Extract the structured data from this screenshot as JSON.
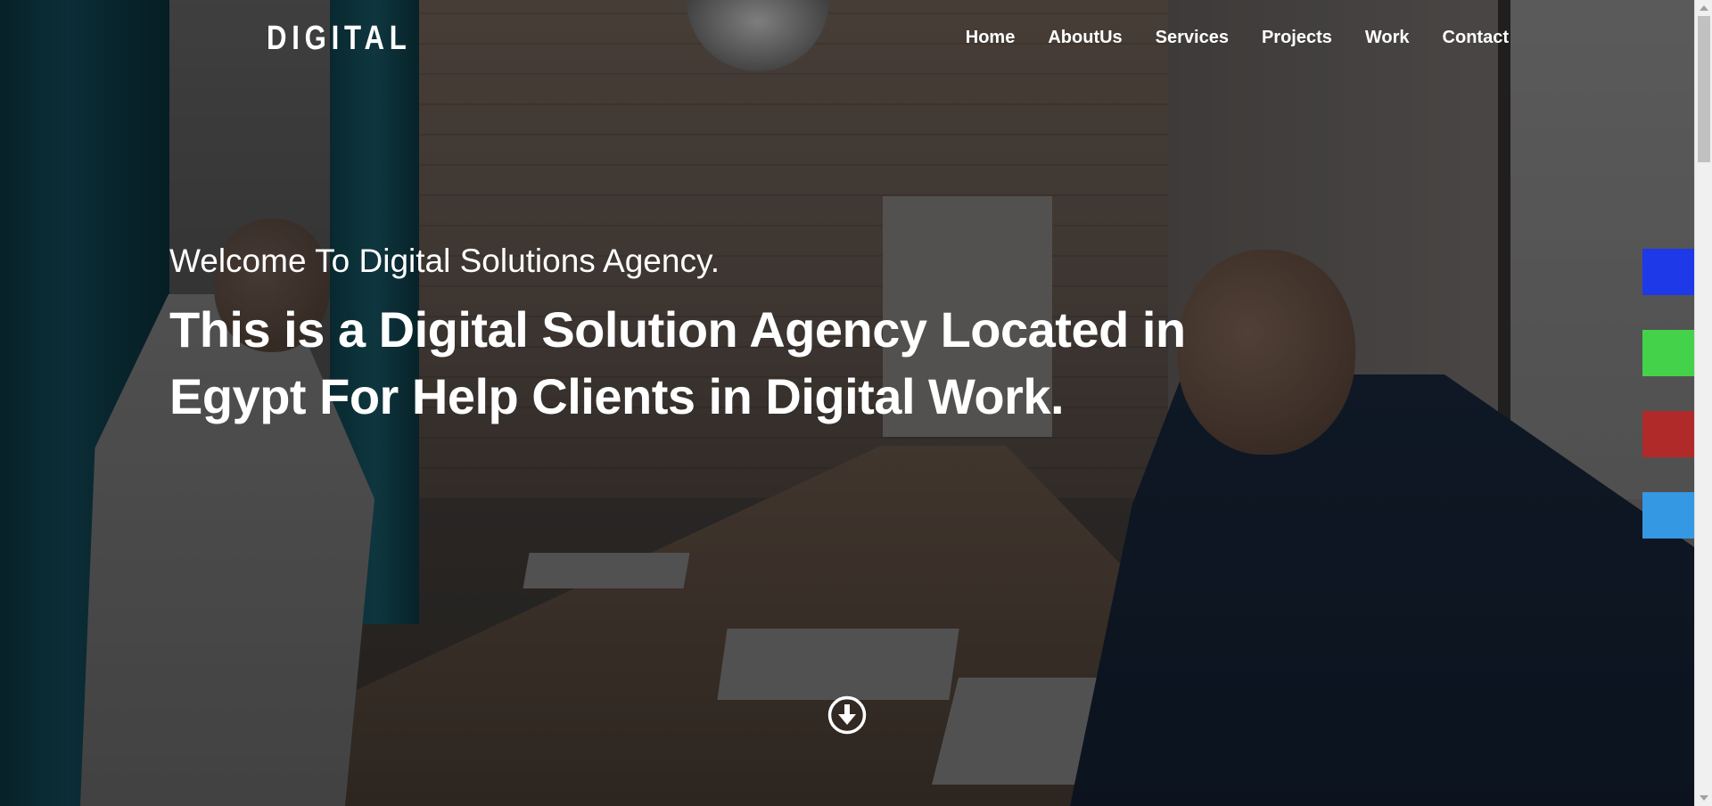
{
  "brand": {
    "logo_text": "DIGITAL"
  },
  "nav": {
    "items": [
      {
        "label": "Home"
      },
      {
        "label": "AboutUs"
      },
      {
        "label": "Services"
      },
      {
        "label": "Projects"
      },
      {
        "label": "Work"
      },
      {
        "label": "Contact"
      }
    ]
  },
  "hero": {
    "welcome": "Welcome To Digital Solutions Agency.",
    "headline": "This is a Digital Solution Agency Located in Egypt For Help Clients in Digital Work.",
    "scroll_icon": "arrow-circle-down-icon"
  },
  "color_switcher": {
    "swatches": [
      {
        "color": "#1e3ae8"
      },
      {
        "color": "#45d24b"
      },
      {
        "color": "#b02a2a"
      },
      {
        "color": "#3598e3"
      }
    ]
  }
}
